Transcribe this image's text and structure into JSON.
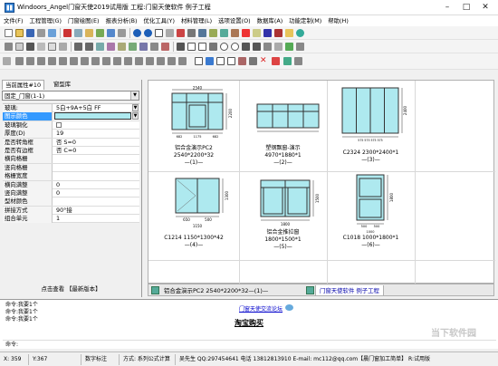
{
  "window": {
    "title": "Windoors_Angel门窗天使2019试用版  工程:门窗天使软件 例子工程",
    "controls": [
      "minimize-icon",
      "maximize-icon",
      "close-icon"
    ]
  },
  "menu": {
    "items": [
      "文件(F)",
      "工程管理(G)",
      "门窗绘图(E)",
      "报表分析(B)",
      "优化工具(Y)",
      "材料管理(L)",
      "选项设置(O)",
      "数据库(A)",
      "功能定制(M)",
      "帮助(H)"
    ]
  },
  "left_panel": {
    "tabs": [
      "当前属性#10",
      "窗型库"
    ],
    "combo_value": "固定_门窗(1-1)",
    "properties": [
      {
        "name": "玻璃:",
        "value": "5白+9A+5白 FF",
        "kind": "text"
      },
      {
        "name": "图示颜色",
        "value": "",
        "kind": "color"
      },
      {
        "name": "玻璃钢化",
        "value": "",
        "kind": "check"
      },
      {
        "name": "厚度(D)",
        "value": "19",
        "kind": "text"
      },
      {
        "name": "是否转角框",
        "value": "否 S=0",
        "kind": "text"
      },
      {
        "name": "是否有边框",
        "value": "否 C=0",
        "kind": "text"
      },
      {
        "name": "横向格栅",
        "value": "",
        "kind": "text"
      },
      {
        "name": "竖向格栅",
        "value": "",
        "kind": "text"
      },
      {
        "name": "格栅宽度",
        "value": "",
        "kind": "text"
      },
      {
        "name": "横向满整",
        "value": "0",
        "kind": "text"
      },
      {
        "name": "竖向满整",
        "value": "0",
        "kind": "text"
      },
      {
        "name": "型材颜色",
        "value": "",
        "kind": "text"
      },
      {
        "name": "拼接方式",
        "value": "90°接",
        "kind": "text"
      },
      {
        "name": "组合单元",
        "value": "1",
        "kind": "text"
      }
    ],
    "footer": "点击查看 【最新版本】"
  },
  "drawings": [
    {
      "name": "铝合金演示PC2",
      "size": "2540*2200*32",
      "index": "—(1)—"
    },
    {
      "name": "塑钢飘窗-演示",
      "size": "4970*1880*1",
      "index": "—(2)—"
    },
    {
      "name": "C2324  2300*2400*1",
      "size": "",
      "index": "—(3)—"
    },
    {
      "name": "C1214  1150*1300*42",
      "size": "",
      "index": "—(4)—"
    },
    {
      "name": "铝合金推拉窗",
      "size": "1800*1500*1",
      "index": "—(5)—"
    },
    {
      "name": "C1018  1000*1800*1",
      "size": "",
      "index": "—(6)—"
    }
  ],
  "dims": {
    "d1_top": "2540",
    "d1_side": "2200",
    "d1_b1": "682",
    "d1_b2": "1175",
    "d1_b3": "682",
    "d3_side": "2400",
    "d3_bottom": "575 575 575 575",
    "d4_side": "1300",
    "d4_b1": "650",
    "d4_b2": "500",
    "d4_total": "1150",
    "d5_side": "1500",
    "d5_total": "1800",
    "d6_side": "1800",
    "d6_b1": "500",
    "d6_b2": "500",
    "d6_total": "1000"
  },
  "doc_tabs": [
    "铝合金演示PC2  2540*2200*32—(1)—",
    "门窗天使软件 例子工程"
  ],
  "messages": {
    "lines": [
      "命令:我要1个",
      "命令:我要1个",
      "命令:我要1个"
    ],
    "forum_link": "门窗天使交流论坛",
    "shop_link": "淘宝购买",
    "prompt": "命令:"
  },
  "status": {
    "x": "X: 359",
    "y": "Y:367",
    "mode": "数字标注",
    "formula": "方式: 系列公式计算",
    "contact": "吴先生 QQ:297454641 电话 13812813910 E-mail: mc112@qq.com【晨门窗加工简单】 R:试用版"
  },
  "watermark": "当下软件园"
}
